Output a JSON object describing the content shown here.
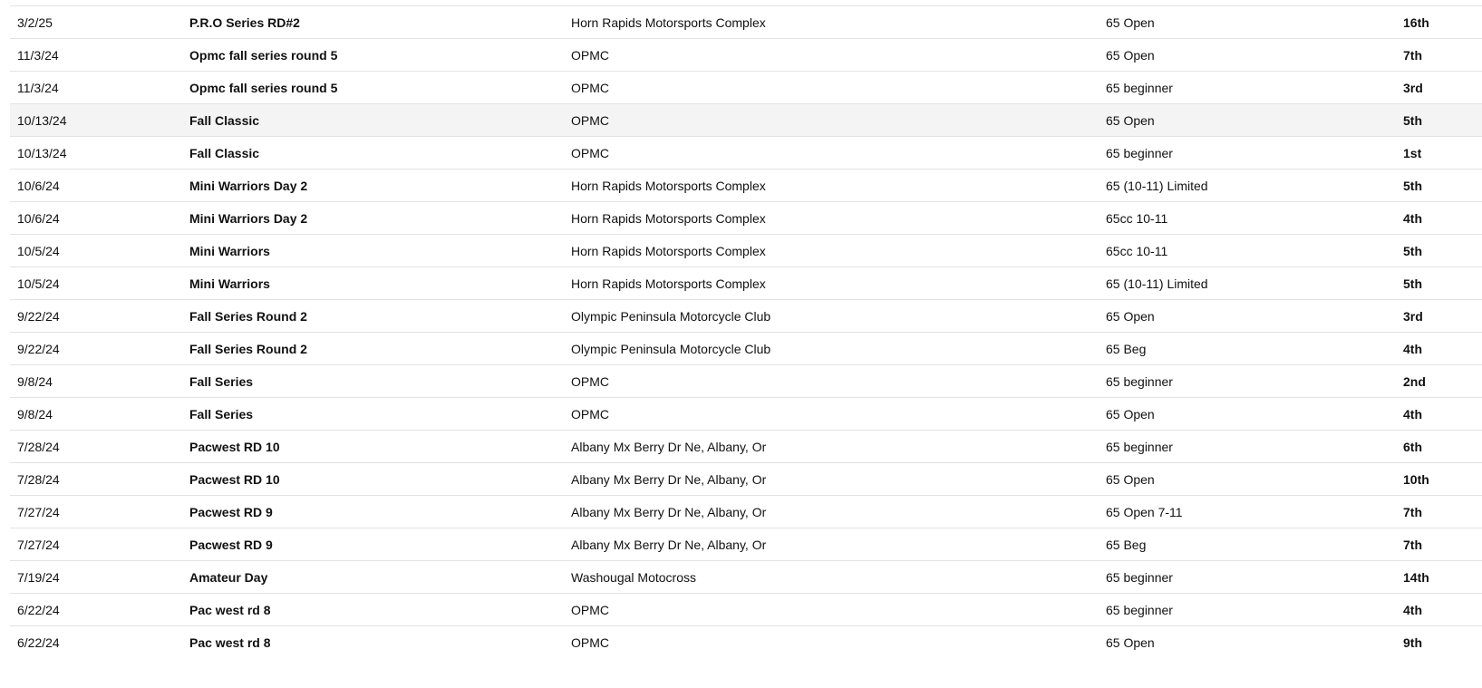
{
  "results": {
    "highlight_row_index": 3,
    "rows": [
      {
        "date": "3/2/25",
        "event": "P.R.O Series RD#2",
        "track": "Horn Rapids Motorsports Complex",
        "class": "65 Open",
        "place": "16th"
      },
      {
        "date": "11/3/24",
        "event": "Opmc fall series round 5",
        "track": "OPMC",
        "class": "65 Open",
        "place": "7th"
      },
      {
        "date": "11/3/24",
        "event": "Opmc fall series round 5",
        "track": "OPMC",
        "class": "65 beginner",
        "place": "3rd"
      },
      {
        "date": "10/13/24",
        "event": "Fall Classic",
        "track": "OPMC",
        "class": "65 Open",
        "place": "5th"
      },
      {
        "date": "10/13/24",
        "event": "Fall Classic",
        "track": "OPMC",
        "class": "65 beginner",
        "place": "1st"
      },
      {
        "date": "10/6/24",
        "event": "Mini Warriors Day 2",
        "track": "Horn Rapids Motorsports Complex",
        "class": "65 (10-11) Limited",
        "place": "5th"
      },
      {
        "date": "10/6/24",
        "event": "Mini Warriors Day 2",
        "track": "Horn Rapids Motorsports Complex",
        "class": "65cc 10-11",
        "place": "4th"
      },
      {
        "date": "10/5/24",
        "event": "Mini Warriors",
        "track": "Horn Rapids Motorsports Complex",
        "class": "65cc 10-11",
        "place": "5th"
      },
      {
        "date": "10/5/24",
        "event": "Mini Warriors",
        "track": "Horn Rapids Motorsports Complex",
        "class": "65 (10-11) Limited",
        "place": "5th"
      },
      {
        "date": "9/22/24",
        "event": "Fall Series Round 2",
        "track": "Olympic Peninsula Motorcycle Club",
        "class": "65 Open",
        "place": "3rd"
      },
      {
        "date": "9/22/24",
        "event": "Fall Series Round 2",
        "track": "Olympic Peninsula Motorcycle Club",
        "class": "65 Beg",
        "place": "4th"
      },
      {
        "date": "9/8/24",
        "event": "Fall Series",
        "track": "OPMC",
        "class": "65 beginner",
        "place": "2nd"
      },
      {
        "date": "9/8/24",
        "event": "Fall Series",
        "track": "OPMC",
        "class": "65 Open",
        "place": "4th"
      },
      {
        "date": "7/28/24",
        "event": "Pacwest RD 10",
        "track": "Albany Mx Berry Dr Ne, Albany, Or",
        "class": "65 beginner",
        "place": "6th"
      },
      {
        "date": "7/28/24",
        "event": "Pacwest RD 10",
        "track": "Albany Mx Berry Dr Ne, Albany, Or",
        "class": "65 Open",
        "place": "10th"
      },
      {
        "date": "7/27/24",
        "event": "Pacwest RD 9",
        "track": "Albany Mx Berry Dr Ne, Albany, Or",
        "class": "65 Open 7-11",
        "place": "7th"
      },
      {
        "date": "7/27/24",
        "event": "Pacwest RD 9",
        "track": "Albany Mx Berry Dr Ne, Albany, Or",
        "class": "65 Beg",
        "place": "7th"
      },
      {
        "date": "7/19/24",
        "event": "Amateur Day",
        "track": "Washougal Motocross",
        "class": "65 beginner",
        "place": "14th"
      },
      {
        "date": "6/22/24",
        "event": "Pac west rd 8",
        "track": "OPMC",
        "class": "65 beginner",
        "place": "4th"
      },
      {
        "date": "6/22/24",
        "event": "Pac west rd 8",
        "track": "OPMC",
        "class": "65 Open",
        "place": "9th"
      }
    ]
  }
}
